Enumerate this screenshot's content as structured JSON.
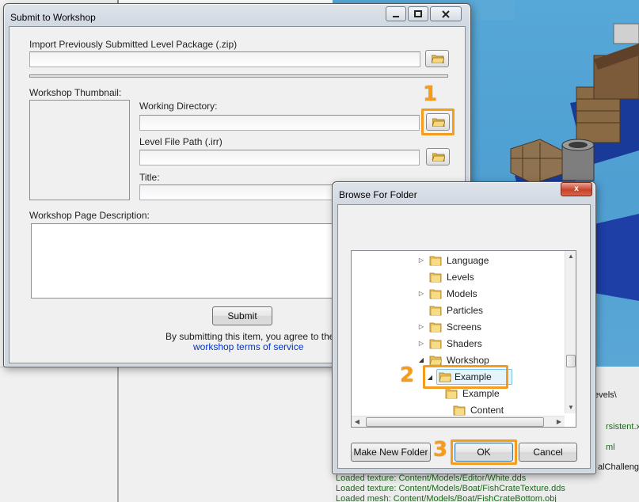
{
  "log": {
    "fragments": [
      "evels\\",
      "rsistent.xm",
      "ml",
      "alChalleng"
    ],
    "lines": [
      "Loaded texture: Content/Models/Editor/White.dds",
      "Loaded texture: Content/Models/Boat/FishCrateTexture.dds",
      "Loaded mesh: Content/Models/Boat/FishCrateBottom.obj"
    ]
  },
  "submit_dialog": {
    "title": "Submit to Workshop",
    "import_label": "Import Previously Submitted Level Package (.zip)",
    "thumbnail_label": "Workshop Thumbnail:",
    "working_dir_label": "Working Directory:",
    "level_path_label": "Level File Path (.irr)",
    "title_label": "Title:",
    "description_label": "Workshop Page Description:",
    "submit_label": "Submit",
    "agree_text": "By submitting this item, you agree to the",
    "terms_link": "workshop terms of service"
  },
  "browse_dialog": {
    "title": "Browse For Folder",
    "close_glyph": "x",
    "tree": [
      {
        "name": "Language",
        "expandable": true
      },
      {
        "name": "Levels",
        "expandable": false
      },
      {
        "name": "Models",
        "expandable": true
      },
      {
        "name": "Particles",
        "expandable": false
      },
      {
        "name": "Screens",
        "expandable": true
      },
      {
        "name": "Shaders",
        "expandable": true
      },
      {
        "name": "Workshop",
        "expandable": true,
        "expanded": true
      },
      {
        "name": "Example",
        "expandable": true,
        "expanded": true,
        "selected": true
      },
      {
        "name": "Example",
        "expandable": false
      },
      {
        "name": "Content",
        "expandable": false
      }
    ],
    "make_new_folder_label": "Make New Folder",
    "ok_label": "OK",
    "cancel_label": "Cancel"
  },
  "callouts": [
    "1",
    "2",
    "3"
  ],
  "colors": {
    "callout": "#f39c1e",
    "link": "#0033cc",
    "sky": "#4f9fd2",
    "log_text": "#1a6a1a"
  }
}
